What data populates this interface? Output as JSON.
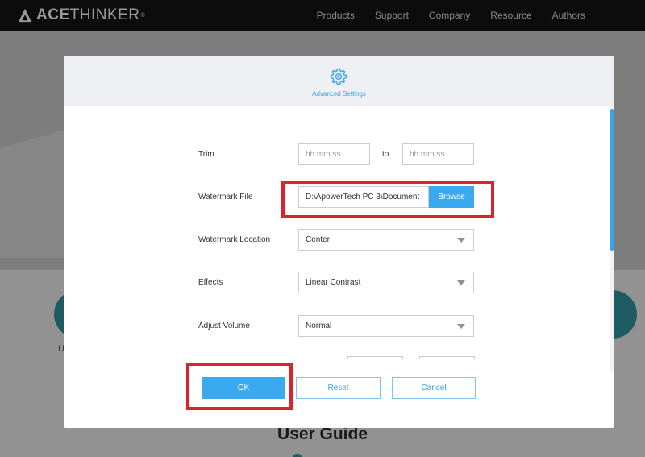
{
  "brand": {
    "name_bold": "ACE",
    "name_light": "THINKER",
    "reg_mark": "®"
  },
  "nav": {
    "items": [
      "Products",
      "Support",
      "Company",
      "Resource",
      "Authors"
    ]
  },
  "background": {
    "heading": "User Guide",
    "partial_letter": "U"
  },
  "dialog": {
    "title": "Advanced Settings",
    "trim": {
      "label": "Trim",
      "start_placeholder": "hh:mm:ss",
      "to_label": "to",
      "end_placeholder": "hh:mm:ss"
    },
    "watermark_file": {
      "label": "Watermark File",
      "value": "D:\\ApowerTech PC 3\\Document",
      "browse_label": "Browse"
    },
    "watermark_location": {
      "label": "Watermark Location",
      "value": "Center"
    },
    "effects": {
      "label": "Effects",
      "value": "Linear Contrast"
    },
    "adjust_volume": {
      "label": "Adjust Volume",
      "value": "Normal"
    },
    "buttons": {
      "ok": "OK",
      "reset": "Reset",
      "cancel": "Cancel"
    }
  },
  "colors": {
    "accent": "#3aa9f0",
    "highlight": "#d9232e",
    "nav_bg": "#0c0c0c"
  }
}
